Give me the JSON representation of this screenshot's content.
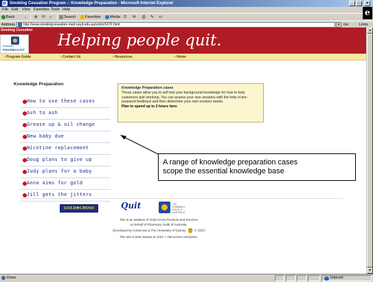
{
  "window": {
    "title": "Smoking Cessation Program :: Knowledge Preparation - Microsoft Internet Explorer",
    "minimize": "_",
    "maximize": "□",
    "close": "×"
  },
  "menu": [
    "File",
    "Edit",
    "View",
    "Favorites",
    "Tools",
    "Help"
  ],
  "toolbar": {
    "back": "Back",
    "forward": "→",
    "stop": "⊗",
    "refresh": "⟳",
    "home": "⌂",
    "search": "Search",
    "favorites": "Favorites",
    "media": "Media",
    "history": "⏲",
    "mail": "✉",
    "print": "⎙",
    "edit": "✎",
    "discuss": "▭"
  },
  "address": {
    "label": "Address",
    "url": "http://www.smokingcessation.med.usyd.edu.au/scb/s/1472.html",
    "dropdown": "▾",
    "go": "Go",
    "links": "Links"
  },
  "site": {
    "banner_tag": "Smoking Cessation",
    "logo_small": "Australian",
    "logo_text": "PHARMACIST",
    "tagline": "Helping people quit.",
    "nav": [
      "Program Guide",
      "Contact Us",
      "Resources",
      "Home"
    ]
  },
  "content": {
    "heading": "Knowledge Preparation",
    "cases": [
      "How to use these cases",
      "Ash to ash",
      "Grease up & oil change",
      "New baby due",
      "Nicotine replacement",
      "Doug plans to give up",
      "Judy plans for a baby",
      "Anna aims for gold",
      "Jill gets the jitters"
    ],
    "info": {
      "title": "Knowledge Preparation cases",
      "body": "These cases allow you to self test your background knowledge for how to help customers quit smoking. You can assess your own answers with the help of pre-prepared feedback and then determine your own revision needs.",
      "plan": "Plan to spend up to 2 hours here"
    }
  },
  "annotation": {
    "line1": "A range of knowledge preparation cases",
    "line2": "scope the essential knowledge base"
  },
  "footer": {
    "goldcross": "GOLD✚CROSS",
    "quit": "Quit",
    "guild_text": [
      "The",
      "PHARMACY",
      "GUILD of",
      "AUSTRALIA"
    ],
    "line1": "This is an initiative of Gold Cross Products and Services",
    "line2": "on behalf of Pharmacy Guild of Australia.",
    "line3a": "Developed by Goldcross & The University of Sydney",
    "line3b": "© 2003",
    "line4": "This site is best viewed at 1024 × 768 screen resolution."
  },
  "status": {
    "text": "Done",
    "zone": "Internet"
  },
  "colors": {
    "banner": "#b01c24",
    "nav_bg": "#f4e8a4",
    "bullet": "#c8141c",
    "link": "#1a2a8a",
    "info_bg": "#fbf6cf"
  }
}
